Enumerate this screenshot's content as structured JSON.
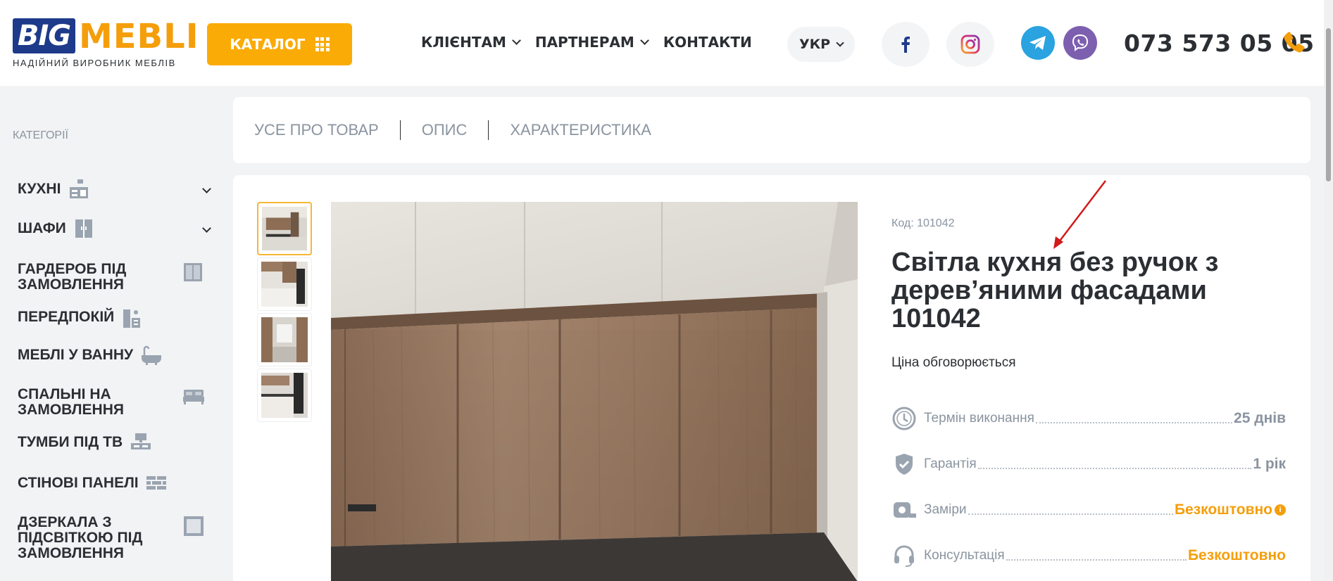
{
  "header": {
    "logo_big": "BIG",
    "logo_mebli": "MEBLI",
    "logo_tagline": "НАДІЙНИЙ ВИРОБНИК МЕБЛІВ",
    "catalog_label": "КАТАЛОГ",
    "nav": [
      {
        "label": "КЛІЄНТАМ",
        "dropdown": true
      },
      {
        "label": "ПАРТНЕРАМ",
        "dropdown": true
      },
      {
        "label": "КОНТАКТИ",
        "dropdown": false
      }
    ],
    "language": "УКР",
    "social": [
      "facebook-icon",
      "instagram-icon",
      "telegram-icon",
      "viber-icon"
    ],
    "phone": "073 573 05 05"
  },
  "sidebar": {
    "title": "КАТЕГОРІЇ",
    "items": [
      {
        "label": "КУХНІ",
        "icon": "kitchen-icon",
        "expandable": true
      },
      {
        "label": "ШАФИ",
        "icon": "wardrobe-icon",
        "expandable": true
      },
      {
        "label": "ГАРДЕРОБ ПІД ЗАМОВЛЕННЯ",
        "icon": "closet-icon",
        "expandable": false
      },
      {
        "label": "ПЕРЕДПОКІЙ",
        "icon": "hallway-icon",
        "expandable": false
      },
      {
        "label": "МЕБЛІ У ВАННУ",
        "icon": "bathtub-icon",
        "expandable": false
      },
      {
        "label": "СПАЛЬНІ НА ЗАМОВЛЕННЯ",
        "icon": "bed-icon",
        "expandable": false
      },
      {
        "label": "ТУМБИ ПІД ТВ",
        "icon": "tv-stand-icon",
        "expandable": false
      },
      {
        "label": "СТІНОВІ ПАНЕЛІ",
        "icon": "wall-panel-icon",
        "expandable": false
      },
      {
        "label": "ДЗЕРКАЛА З ПІДСВІТКОЮ ПІД ЗАМОВЛЕННЯ",
        "icon": "mirror-icon",
        "expandable": false
      }
    ]
  },
  "tabs": [
    "УСЕ ПРО ТОВАР",
    "ОПИС",
    "ХАРАКТЕРИСТИКА"
  ],
  "product": {
    "code": "Код: 101042",
    "title": "Світла кухня без ручок з дерев’яними фасадами 101042",
    "price": "Ціна обговорюється",
    "specs": [
      {
        "label": "Термін виконання",
        "value": "25 днів",
        "icon": "clock-icon",
        "highlight": false
      },
      {
        "label": "Гарантія",
        "value": "1 рік",
        "icon": "shield-check-icon",
        "highlight": false
      },
      {
        "label": "Заміри",
        "value": "Безкоштовно",
        "icon": "tape-measure-icon",
        "highlight": true,
        "info": "i"
      },
      {
        "label": "Консультація",
        "value": "Безкоштовно",
        "icon": "headset-icon",
        "highlight": true
      }
    ]
  },
  "colors": {
    "brand_blue": "#1e3a8a",
    "brand_orange": "#f59e0b",
    "text_dark": "#2b2f33",
    "text_muted": "#8a94a0",
    "annotation_arrow": "#d11a1a"
  }
}
